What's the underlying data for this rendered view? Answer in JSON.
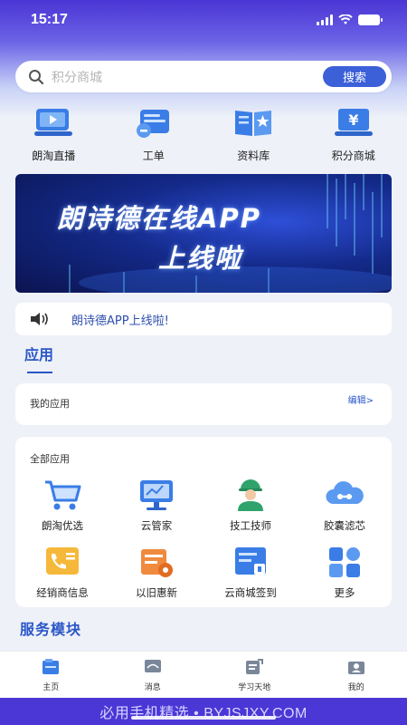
{
  "status_bar": {
    "time": "15:17"
  },
  "search": {
    "placeholder": "积分商城",
    "button_label": "搜索"
  },
  "quick_nav": [
    {
      "label": "朗淘直播",
      "icon": "live-tv-icon"
    },
    {
      "label": "工单",
      "icon": "work-order-icon"
    },
    {
      "label": "资料库",
      "icon": "book-library-icon"
    },
    {
      "label": "积分商城",
      "icon": "points-mall-icon"
    }
  ],
  "banner": {
    "line1": "朗诗德在线APP",
    "line2": "上线啦"
  },
  "notice": {
    "text": "朗诗德APP上线啦!"
  },
  "apps_section": {
    "title": "应用"
  },
  "my_apps": {
    "title": "我的应用",
    "edit_label": "编辑>"
  },
  "all_apps": {
    "title": "全部应用",
    "items": [
      {
        "label": "朗淘优选",
        "icon": "shopping-cart-icon"
      },
      {
        "label": "云管家",
        "icon": "cloud-monitor-icon"
      },
      {
        "label": "技工技师",
        "icon": "technician-icon"
      },
      {
        "label": "胶囊滤芯",
        "icon": "cloud-filter-icon"
      },
      {
        "label": "经销商信息",
        "icon": "dealer-phone-icon"
      },
      {
        "label": "以旧惠新",
        "icon": "trade-in-icon"
      },
      {
        "label": "云商城签到",
        "icon": "check-in-icon"
      },
      {
        "label": "更多",
        "icon": "more-grid-icon"
      }
    ]
  },
  "service_section": {
    "title": "服务模块"
  },
  "tabbar": [
    {
      "label": "主页",
      "icon": "home-icon"
    },
    {
      "label": "消息",
      "icon": "message-icon"
    },
    {
      "label": "学习天地",
      "icon": "study-icon"
    },
    {
      "label": "我的",
      "icon": "profile-icon"
    }
  ],
  "footer": {
    "watermark": "必用手机精选 • BYJSJXY.COM"
  },
  "colors": {
    "primary": "#3c60d8",
    "accent_text": "#2b56c8",
    "header_purple": "#4a35d4"
  }
}
